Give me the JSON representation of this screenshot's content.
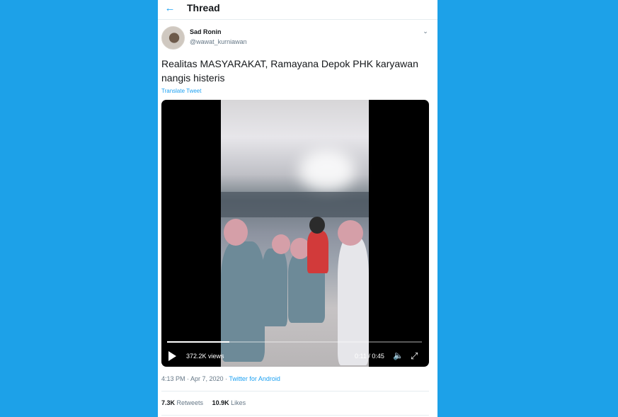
{
  "header": {
    "back_icon": "back-arrow-icon",
    "title": "Thread"
  },
  "tweet": {
    "author_name": "Sad Ronin",
    "author_handle": "@wawat_kurniawan",
    "menu_icon": "chevron-down-icon",
    "text": "Realitas MASYARAKAT, Ramayana Depok PHK karyawan nangis histeris",
    "translate_label": "Translate Tweet",
    "timestamp": "4:13 PM · Apr 7, 2020 · ",
    "source": "Twitter for Android",
    "retweets_count": "7.3K",
    "retweets_label": "Retweets",
    "likes_count": "10.9K",
    "likes_label": "Likes"
  },
  "video": {
    "views": "372.2K views",
    "time": "0:11 / 0:45",
    "progress": 0.244,
    "play_icon": "play-icon",
    "volume_icon": "volume-icon",
    "fullscreen_icon": "fullscreen-icon"
  },
  "colors": {
    "background": "#1da1e8",
    "accent": "#1da1f2",
    "text": "#14171a",
    "muted": "#657786"
  }
}
